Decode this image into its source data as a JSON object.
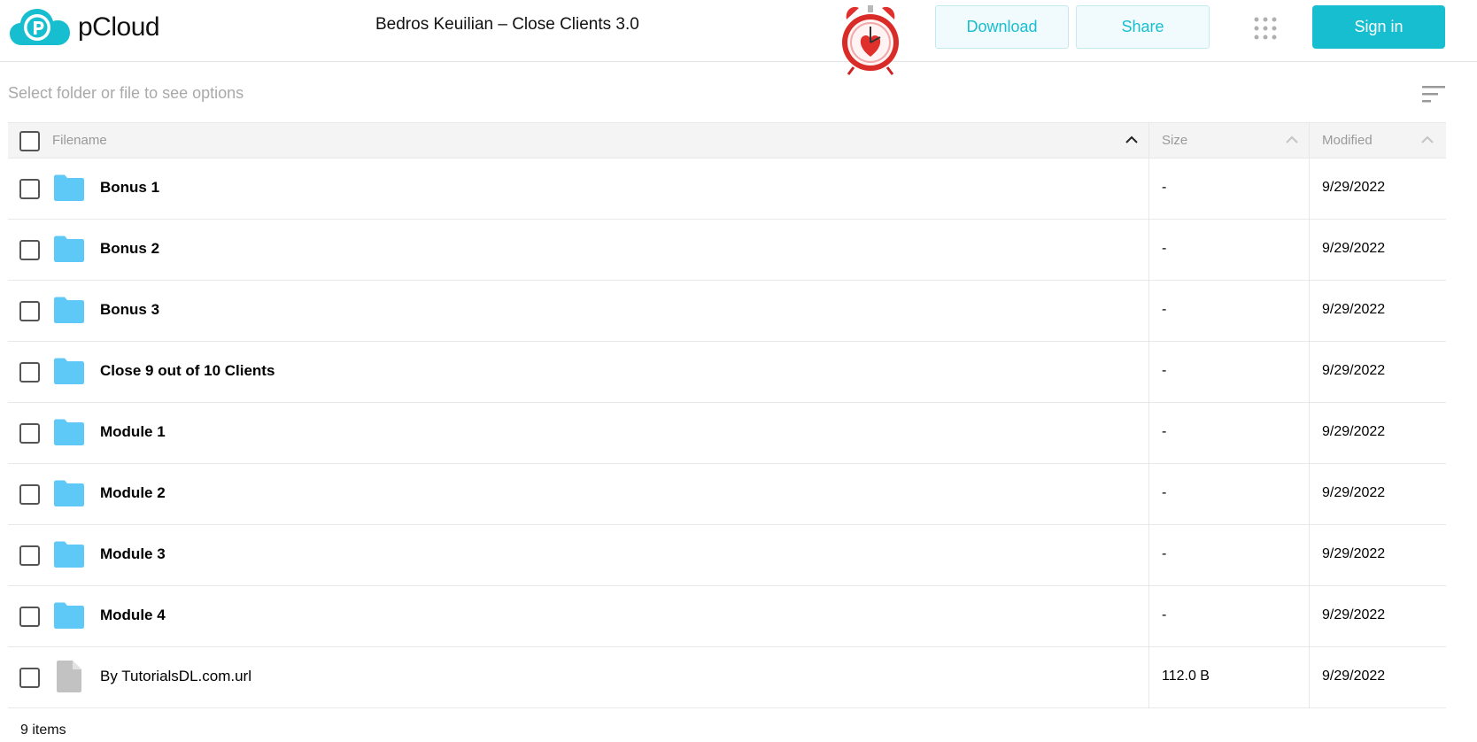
{
  "header": {
    "logo_text": "pCloud",
    "logo_icon": "pcloud-p-cloud-icon",
    "title": "Bedros Keuilian – Close Clients 3.0",
    "download_label": "Download",
    "share_label": "Share",
    "apps_icon": "grid-dots-icon",
    "signin_label": "Sign in",
    "accent_color": "#17bed0"
  },
  "toolbar": {
    "hint": "Select folder or file to see options",
    "sort_icon": "sort-lines-icon"
  },
  "table": {
    "headers": {
      "name": "Filename",
      "size": "Size",
      "modified": "Modified"
    },
    "rows": [
      {
        "type": "folder",
        "name": "Bonus 1",
        "size": "-",
        "modified": "9/29/2022"
      },
      {
        "type": "folder",
        "name": "Bonus 2",
        "size": "-",
        "modified": "9/29/2022"
      },
      {
        "type": "folder",
        "name": "Bonus 3",
        "size": "-",
        "modified": "9/29/2022"
      },
      {
        "type": "folder",
        "name": "Close 9 out of 10 Clients",
        "size": "-",
        "modified": "9/29/2022"
      },
      {
        "type": "folder",
        "name": "Module 1",
        "size": "-",
        "modified": "9/29/2022"
      },
      {
        "type": "folder",
        "name": "Module 2",
        "size": "-",
        "modified": "9/29/2022"
      },
      {
        "type": "folder",
        "name": "Module 3",
        "size": "-",
        "modified": "9/29/2022"
      },
      {
        "type": "folder",
        "name": "Module 4",
        "size": "-",
        "modified": "9/29/2022"
      },
      {
        "type": "file",
        "name": "By TutorialsDL.com.url",
        "size": "112.0 B",
        "modified": "9/29/2022"
      }
    ]
  },
  "footer": {
    "count": "9 items"
  },
  "colors": {
    "folder": "#5ec8f7",
    "file": "#c2c2c2"
  }
}
